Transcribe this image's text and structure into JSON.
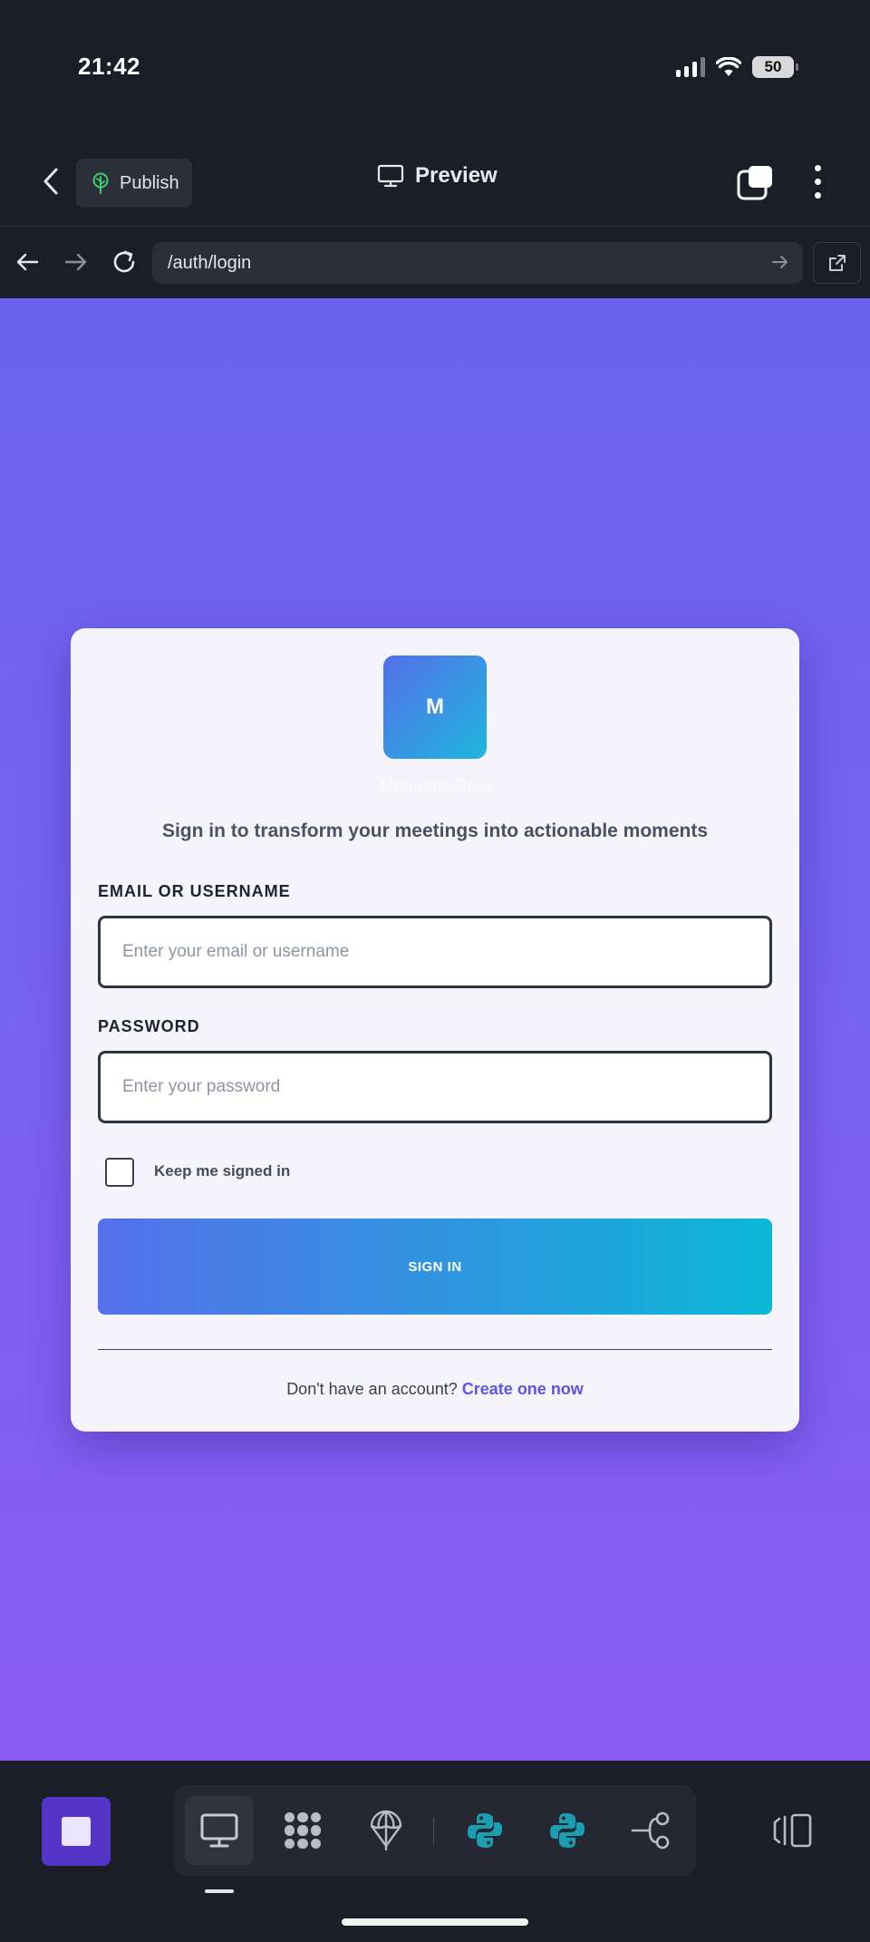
{
  "status_bar": {
    "time": "21:42",
    "battery": "50",
    "icons": [
      "signal-icon",
      "wifi-icon",
      "battery-icon"
    ]
  },
  "toolbar": {
    "back_icon": "chevron-left-icon",
    "publish_label": "Publish",
    "publish_icon": "tree-icon",
    "preview_label": "Preview",
    "preview_icon": "monitor-icon",
    "tabs_icon": "tabs-icon",
    "menu_icon": "more-vertical-icon"
  },
  "address_bar": {
    "url": "/auth/login",
    "icons": [
      "arrow-left-icon",
      "arrow-right-icon",
      "refresh-icon",
      "go-arrow-icon",
      "external-link-icon"
    ]
  },
  "login": {
    "logo_letter": "M",
    "brand_name": "Moments Reel",
    "tagline": "Sign in to transform your meetings into actionable moments",
    "email_label": "EMAIL OR USERNAME",
    "email_placeholder": "Enter your email or username",
    "email_value": "",
    "password_label": "PASSWORD",
    "password_placeholder": "Enter your password",
    "password_value": "",
    "remember_label": "Keep me signed in",
    "remember_checked": false,
    "submit_label": "SIGN IN",
    "signup_prompt": "Don't have an account?",
    "signup_link": "Create one now"
  },
  "bottom_bar": {
    "stop_icon": "stop-icon",
    "tools": [
      {
        "icon": "monitor-icon",
        "active": true
      },
      {
        "icon": "packages-icon",
        "active": false
      },
      {
        "icon": "deploy-icon",
        "active": false
      },
      {
        "icon": "python-icon",
        "active": false
      },
      {
        "icon": "python-icon",
        "active": false
      },
      {
        "icon": "git-branch-icon",
        "active": false
      }
    ],
    "layout_icon": "layout-toggle-icon"
  },
  "colors": {
    "app_background": "#1b1e27",
    "preview_gradient_top": "#6a63ef",
    "preview_gradient_bottom": "#8b5cf5",
    "card_background": "#f4f4fa",
    "button_gradient_start": "#5570ea",
    "button_gradient_end": "#0cb8d6",
    "link_color": "#5a55e6",
    "stop_button": "#5535c8",
    "python_teal": "#1a9fb0"
  }
}
